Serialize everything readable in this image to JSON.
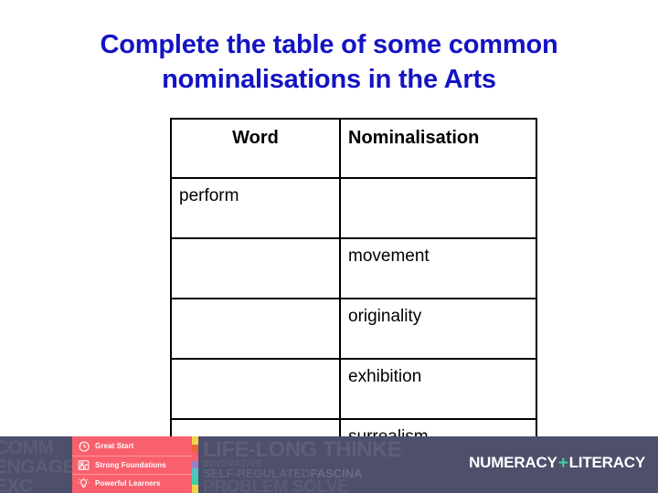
{
  "slide": {
    "background_color": "#ffffff",
    "title": {
      "color": "#1313c4",
      "line1": "Complete the table of some common",
      "line2": "nominalisations in the Arts"
    }
  },
  "table": {
    "columns": [
      "Word",
      "Nominalisation"
    ],
    "rows": [
      {
        "word": "perform",
        "nominalisation": ""
      },
      {
        "word": "",
        "nominalisation": "movement"
      },
      {
        "word": "",
        "nominalisation": "originality"
      },
      {
        "word": "",
        "nominalisation": "exhibition"
      },
      {
        "word": "",
        "nominalisation": "surrealism"
      }
    ]
  },
  "footer": {
    "background_color": "#4e4f6b",
    "accent_color": "#f9606d",
    "ghost_left": [
      "COMM",
      "ENGAGE",
      "EXC"
    ],
    "ghost_right": {
      "line1": "LIFE-LONG THINKE",
      "line2": "INNOVATIVE",
      "line3a": "SELF-REGULATED",
      "line3b": "FASCINA",
      "line4": "PROBLEM SOLVE"
    },
    "pillars": [
      {
        "icon": "clock-icon",
        "label": "Great Start"
      },
      {
        "icon": "building-icon",
        "label": "Strong Foundations"
      },
      {
        "icon": "lightbulb-icon",
        "label": "Powerful Learners"
      }
    ],
    "colour_strip": [
      "#f3d34a",
      "#e8663c",
      "#f9606d",
      "#9b7fc7",
      "#4fc3c7",
      "#3ecfa4",
      "#f3d34a"
    ],
    "logo": {
      "first": "NUMERACY",
      "plus": "+",
      "second": "LITERACY",
      "plus_color": "#3ecfa4"
    }
  }
}
